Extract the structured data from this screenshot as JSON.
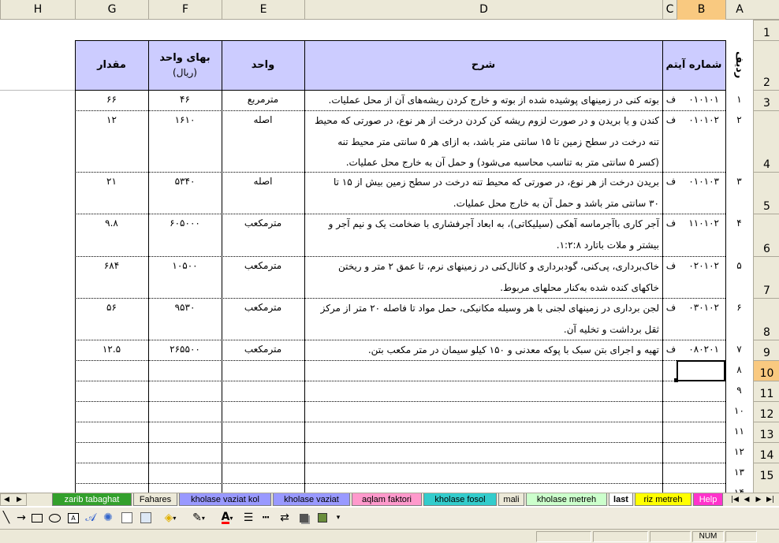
{
  "columns": [
    "H",
    "G",
    "F",
    "E",
    "D",
    "C",
    "B",
    "A"
  ],
  "selected_column": "B",
  "rows": [
    "1",
    "2",
    "3",
    "4",
    "5",
    "6",
    "7",
    "8",
    "9",
    "10",
    "11",
    "12",
    "13",
    "14",
    "15"
  ],
  "selected_row": "10",
  "headers": {
    "radif": "ردیف",
    "item_no": "شماره آیتم",
    "sharh": "شرح",
    "vahed": "واحد",
    "baha_line1": "بهای واحد",
    "baha_line2": "(ریال)",
    "meghdar": "مقدار"
  },
  "items": [
    {
      "radif": "۱",
      "item": "۰۱۰۱۰۱",
      "f": "ف",
      "lines": [
        "بوته کنی در زمینهای پوشیده شده از بوته و خارج کردن ریشه‌های آن از محل عملیات."
      ],
      "unit": "مترمربع",
      "price": "۴۶",
      "qty": "۶۶"
    },
    {
      "radif": "۲",
      "item": "۰۱۰۱۰۲",
      "f": "ف",
      "lines": [
        "کندن و یا بریدن و در صورت لزوم ریشه کن کردن درخت از هر نوع، در صورتی که محیط",
        "تنه درخت در سطح زمین تا ۱۵ سانتی متر باشد، به ازای هر ۵ سانتی متر محیط تنه",
        "(کسر ۵ سانتی متر به تناسب محاسبه می‌شود) و حمل آن به خارج محل عملیات."
      ],
      "unit": "اصله",
      "price": "۱۶۱۰",
      "qty": "۱۲"
    },
    {
      "radif": "۳",
      "item": "۰۱۰۱۰۳",
      "f": "ف",
      "lines": [
        "بریدن درخت از هر نوع، در صورتی که محیط تنه درخت در سطح زمین بیش از ۱۵ تا",
        "۳۰ سانتی متر باشد و حمل آن به خارج محل عملیات."
      ],
      "unit": "اصله",
      "price": "۵۳۴۰",
      "qty": "۲۱"
    },
    {
      "radif": "۴",
      "item": "۱۱۰۱۰۲",
      "f": "ف",
      "lines": [
        "آجر کاری باآجرماسه آهکی (سیلیکاتی)، به ابعاد آجرفشاری با ضخامت یک و نیم آجر و",
        "بیشتر و ملات باتارد ۱:۲:۸."
      ],
      "unit": "مترمکعب",
      "price": "۶۰۵۰۰۰",
      "qty": "۹.۸"
    },
    {
      "radif": "۵",
      "item": "۰۲۰۱۰۲",
      "f": "ف",
      "lines": [
        "خاک‌برداری، پی‌کنی، گودبرداری و کانال‌کنی در زمینهای نرم، تا عمق ۲ متر و ریختن",
        "خاکهای کنده شده به‌کنار محلهای مربوط."
      ],
      "unit": "مترمکعب",
      "price": "۱۰۵۰۰",
      "qty": "۶۸۴"
    },
    {
      "radif": "۶",
      "item": "۰۳۰۱۰۲",
      "f": "ف",
      "lines": [
        "لجن برداری در زمینهای لجنی با هر وسیله مکانیکی، حمل مواد تا فاصله ۲۰ متر از مرکز",
        "ثقل برداشت و تخلیه آن."
      ],
      "unit": "مترمکعب",
      "price": "۹۵۳۰",
      "qty": "۵۶"
    },
    {
      "radif": "۷",
      "item": "۰۸۰۲۰۱",
      "f": "ف",
      "lines": [
        "تهیه و اجرای بتن سبک با پوکه معدنی و ۱۵۰ کیلو سیمان در متر مکعب بتن."
      ],
      "unit": "مترمکعب",
      "price": "۲۶۵۵۰۰",
      "qty": "۱۲.۵"
    }
  ],
  "empty_rows": [
    "۸",
    "۹",
    "۱۰",
    "۱۱",
    "۱۲",
    "۱۳",
    "۱۴"
  ],
  "tabs": [
    {
      "label": "zarib tabaghat",
      "color": "#33A02C",
      "text": "#ffffff"
    },
    {
      "label": "Fahares",
      "color": "#ECE9D8",
      "text": "#000000"
    },
    {
      "label": "kholase vaziat kol",
      "color": "#9999FF",
      "text": "#000000"
    },
    {
      "label": "kholase vaziat",
      "color": "#9999FF",
      "text": "#000000"
    },
    {
      "label": "aqlam faktori",
      "color": "#FF99CC",
      "text": "#000000"
    },
    {
      "label": "kholase fosol",
      "color": "#33CCCC",
      "text": "#000000"
    },
    {
      "label": "mali",
      "color": "#ECE9D8",
      "text": "#000000"
    },
    {
      "label": "kholase metreh",
      "color": "#CCFFCC",
      "text": "#000000"
    },
    {
      "label": "last",
      "color": "#FFFFFF",
      "text": "#000000"
    },
    {
      "label": "riz metreh",
      "color": "#FFFF00",
      "text": "#000000"
    },
    {
      "label": "Help",
      "color": "#FF33CC",
      "text": "#ffffff"
    }
  ],
  "active_tab": "last",
  "status": {
    "num": "NUM"
  },
  "colors": {
    "header_fill": "#CCCCFF",
    "selection_hdr": "#F9C980",
    "chrome": "#ECE9D8"
  }
}
